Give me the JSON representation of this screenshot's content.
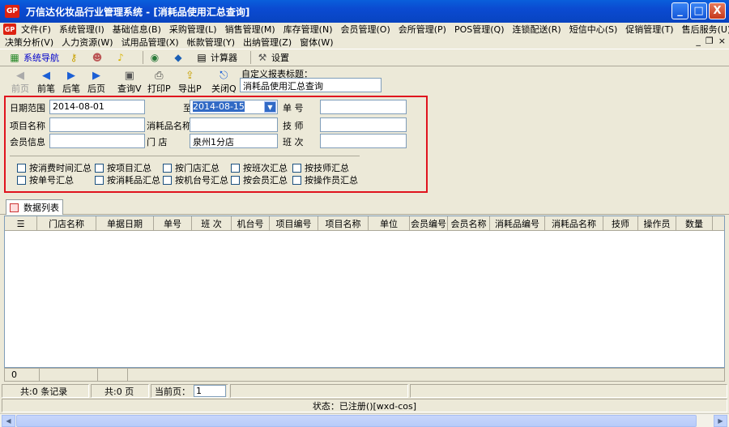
{
  "window": {
    "icon_text": "GP",
    "title": "万信达化妆品行业管理系统  - [消耗品使用汇总查询]",
    "btn_min": "_",
    "btn_max": "□",
    "btn_close": "X"
  },
  "menubar": {
    "row1": [
      "文件(F)",
      "系统管理(I)",
      "基础信息(B)",
      "采购管理(L)",
      "销售管理(M)",
      "库存管理(N)",
      "会员管理(O)",
      "会所管理(P)",
      "POS管理(Q)",
      "连锁配送(R)",
      "短信中心(S)",
      "促销管理(T)",
      "售后服务(U)"
    ],
    "row2": [
      "决策分析(V)",
      "人力资源(W)",
      "试用品管理(X)",
      "帐款管理(Y)",
      "出纳管理(Z)",
      "窗体(W)"
    ],
    "mdi_min": "_",
    "mdi_restore": "❐",
    "mdi_close": "×"
  },
  "toolbar1": {
    "nav": "系统导航",
    "calculator": "计算器",
    "settings": "设置"
  },
  "toolbar2": {
    "first": "前页",
    "prev": "前笔",
    "next": "后笔",
    "last": "后页",
    "query": "查询V",
    "print": "打印P",
    "export": "导出P",
    "close": "关闭Q",
    "custom_title_label": "自定义报表标题：",
    "custom_title_value": "消耗品使用汇总查询"
  },
  "filters": {
    "date_range_label": "日期范围",
    "date_from": "2014-08-01",
    "to_label": "至",
    "date_to": "2014-08-15",
    "doc_no_label": "单    号",
    "doc_no_value": "",
    "item_name_label": "项目名称",
    "item_name_value": "",
    "consumable_label": "消耗品名称",
    "consumable_value": "",
    "tech_label": "技    师",
    "tech_value": "",
    "member_label": "会员信息",
    "member_value": "",
    "store_label": "门    店",
    "store_value": "泉州1分店",
    "shift_label": "班    次",
    "shift_value": ""
  },
  "checks": {
    "by_time": "按消费时间汇总",
    "by_item": "按项目汇总",
    "by_store": "按门店汇总",
    "by_shift": "按班次汇总",
    "by_tech": "按技师汇总",
    "by_doc": "按单号汇总",
    "by_consumable": "按消耗品汇总",
    "by_machine": "按机台号汇总",
    "by_member": "按会员汇总",
    "by_operator": "按操作员汇总"
  },
  "tab": {
    "label": "数据列表"
  },
  "grid": {
    "columns": [
      "门店名称",
      "单据日期",
      "单号",
      "班 次",
      "机台号",
      "项目编号",
      "项目名称",
      "单位",
      "会员编号",
      "会员名称",
      "消耗品编号",
      "消耗品名称",
      "技师",
      "操作员",
      "数量"
    ]
  },
  "footer": {
    "count_value": "0"
  },
  "status": {
    "records": "共:0 条记录",
    "pages": "共:0 页",
    "current_page_label": "当前页：",
    "current_page_value": "1",
    "reg_status": "状态：已注册()[wxd-cos]"
  },
  "colors": {
    "highlight_border": "#e0141e",
    "title_bar": "#0b4ad1"
  }
}
